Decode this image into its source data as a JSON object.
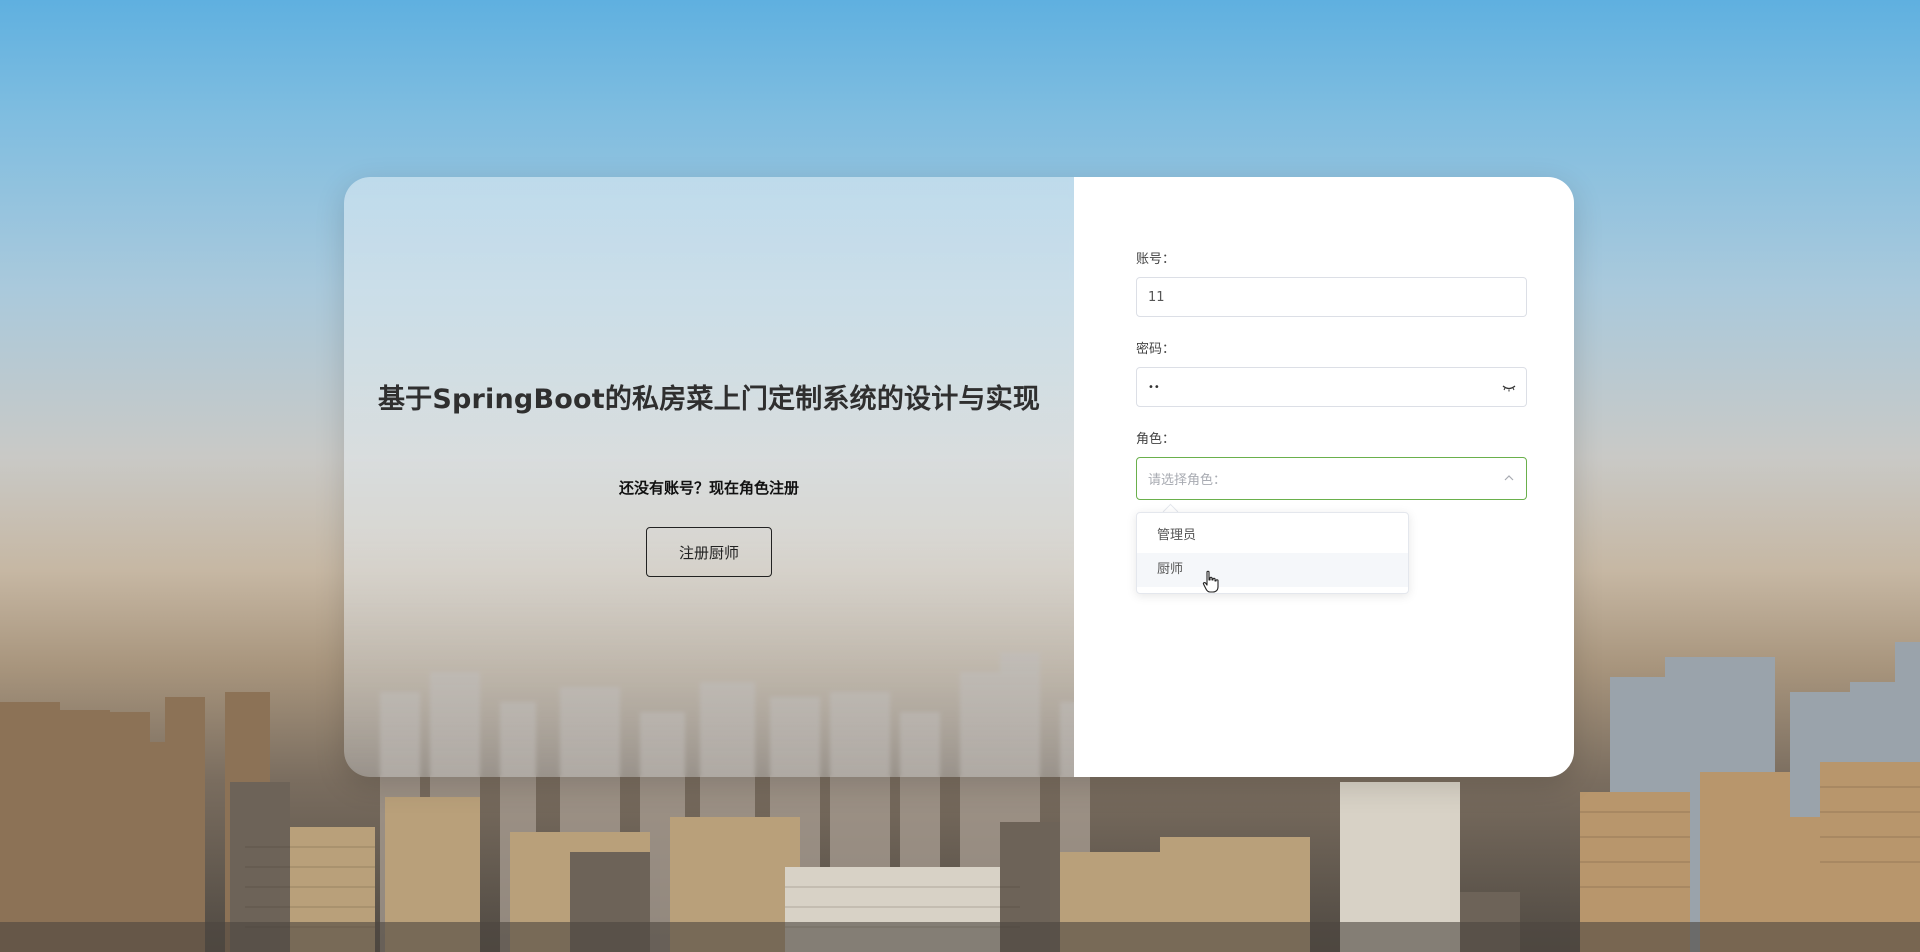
{
  "title": "基于SpringBoot的私房菜上门定制系统的设计与实现",
  "register": {
    "hint": "还没有账号？现在角色注册",
    "chef_button": "注册厨师"
  },
  "login": {
    "account_label": "账号：",
    "account_value": "11",
    "password_label": "密码：",
    "password_value": "••",
    "role_label": "角色：",
    "role_placeholder": "请选择角色："
  },
  "role_options": [
    "管理员",
    "厨师"
  ],
  "colors": {
    "select_focus_border": "#6ab04c",
    "card_right_bg": "#ffffff"
  }
}
